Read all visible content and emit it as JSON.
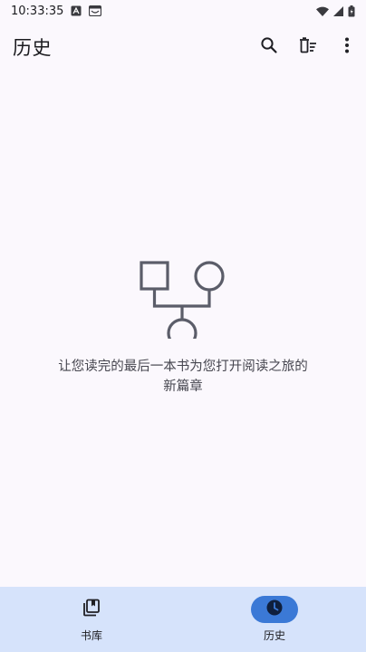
{
  "status_bar": {
    "time": "10:33:35",
    "icons": [
      "a-notification-icon",
      "mail-notification-icon",
      "wifi-icon",
      "signal-icon",
      "battery-icon"
    ]
  },
  "top_bar": {
    "title": "历史",
    "actions": [
      "search-icon",
      "clear-history-icon",
      "more-vert-icon"
    ]
  },
  "empty_state": {
    "icon": "history-empty-illustration",
    "message": "让您读完的最后一本书为您打开阅读之旅的新篇章"
  },
  "bottom_nav": {
    "items": [
      {
        "label": "书库",
        "icon": "library-icon",
        "active": false
      },
      {
        "label": "历史",
        "icon": "history-clock-icon",
        "active": true
      }
    ]
  },
  "colors": {
    "background": "#fbf8fd",
    "nav_background": "#d6e3fb",
    "nav_active_indicator": "#3b79d6",
    "illustration": "#5b5d69"
  }
}
